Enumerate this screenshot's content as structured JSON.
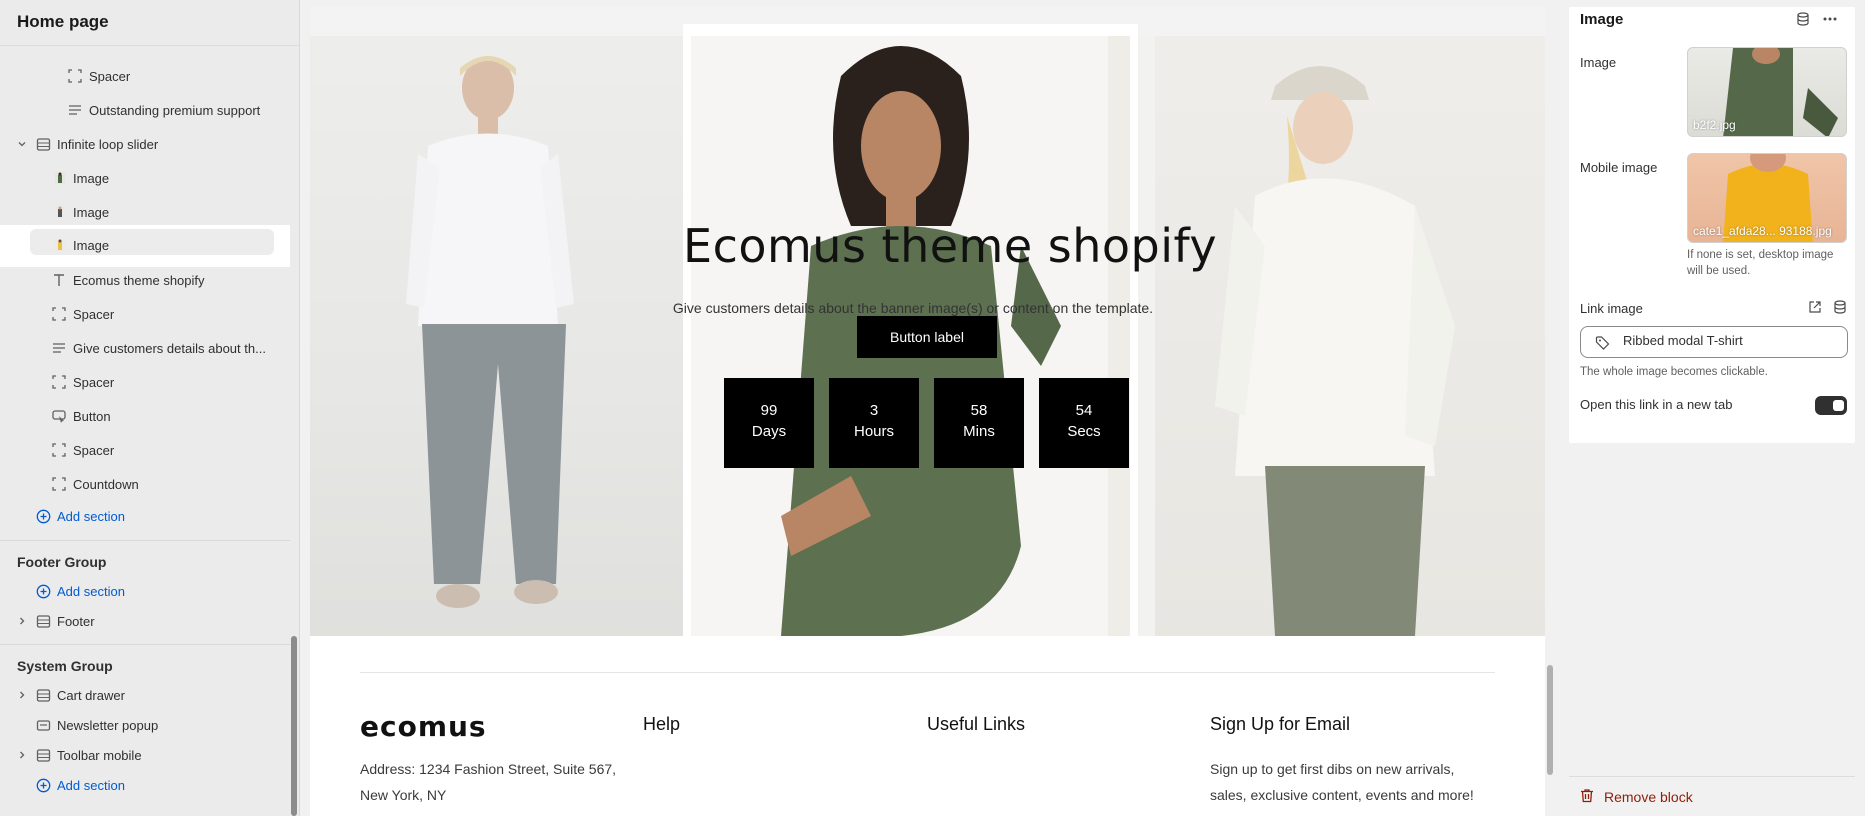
{
  "sidebar": {
    "title": "Home page",
    "items": {
      "spacer_a": "Spacer",
      "outstanding": "Outstanding premium support",
      "loop_slider": "Infinite loop slider",
      "image1": "Image",
      "image2": "Image",
      "image3": "Image",
      "heading": "Ecomus theme shopify",
      "spacer_b": "Spacer",
      "give": "Give customers details about th...",
      "spacer_c": "Spacer",
      "button": "Button",
      "spacer_d": "Spacer",
      "countdown": "Countdown"
    },
    "add_section": "Add section",
    "footer_group": {
      "title": "Footer Group",
      "add_section": "Add section",
      "footer": "Footer"
    },
    "system_group": {
      "title": "System Group",
      "cart": "Cart drawer",
      "newsletter": "Newsletter popup",
      "toolbar": "Toolbar mobile",
      "add_section": "Add section"
    }
  },
  "slide": {
    "title": "Ecomus theme shopify",
    "subtitle": "Give customers details about the banner image(s) or content on the template.",
    "button": "Button label",
    "countdown": [
      {
        "value": "99",
        "unit": "Days"
      },
      {
        "value": "3",
        "unit": "Hours"
      },
      {
        "value": "58",
        "unit": "Mins"
      },
      {
        "value": "54",
        "unit": "Secs"
      }
    ]
  },
  "footer": {
    "logo": "ecomus",
    "help": "Help",
    "useful_links": "Useful Links",
    "signup": "Sign Up for Email",
    "address_1": "Address: 1234 Fashion Street, Suite 567,",
    "address_2": "New York, NY",
    "signup_text_1": "Sign up to get first dibs on new arrivals,",
    "signup_text_2": "sales, exclusive content, events and more!"
  },
  "panel": {
    "title": "Image",
    "image_label": "Image",
    "image_file": "b2f2.jpg",
    "mobile_label": "Mobile image",
    "mobile_file": "cate1_afda28... 93188.jpg",
    "mobile_hint": "If none is set, desktop image will be used.",
    "link_label": "Link image",
    "link_value": "Ribbed modal T-shirt",
    "link_hint": "The whole image becomes clickable.",
    "newtab_label": "Open this link in a new tab",
    "newtab_on": true,
    "remove": "Remove block"
  },
  "colors": {
    "accent": "#005bd3",
    "danger": "#8e1f0b",
    "sidebar_bg": "#ebebeb"
  }
}
